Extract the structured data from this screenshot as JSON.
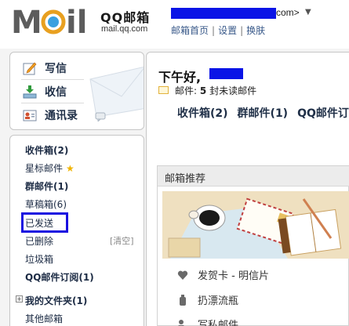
{
  "header": {
    "logo_text": "QQ邮箱",
    "logo_url": "mail.qq.com",
    "email_domain": "com>",
    "links": [
      "邮箱首页",
      "设置",
      "换肤"
    ],
    "separator": "|"
  },
  "nav": {
    "compose": "写信",
    "inbox": "收信",
    "contacts": "通讯录"
  },
  "folders": {
    "inbox": "收件箱(2)",
    "starred": "星标邮件",
    "group": "群邮件(1)",
    "drafts": "草稿箱(6)",
    "sent": "已发送",
    "deleted": "已删除",
    "clear": "[清空]",
    "spam": "垃圾箱",
    "subscriptions": "QQ邮件订阅(1)",
    "my_folders": "我的文件夹(1)",
    "other": "其他邮箱"
  },
  "main": {
    "greeting": "下午好,",
    "mail_prefix": "邮件:",
    "mail_count": "5",
    "mail_suffix": "封未读邮件",
    "quick_links": [
      "收件箱(2)",
      "群邮件(1)",
      "QQ邮件订"
    ]
  },
  "recommend": {
    "title": "邮箱推荐",
    "items": [
      "发贺卡 - 明信片",
      "扔漂流瓶",
      "写私邮件"
    ]
  },
  "colors": {
    "redaction": "#0a14e6",
    "highlight_box": "#1a10e0",
    "star": "#f0b400"
  }
}
